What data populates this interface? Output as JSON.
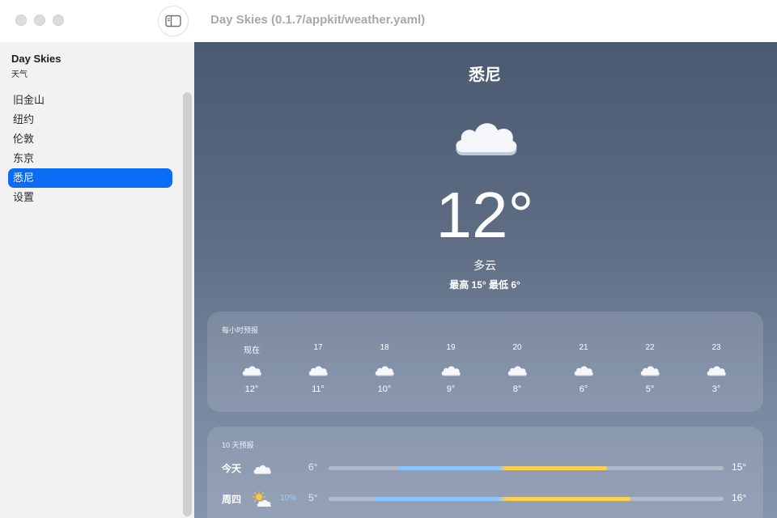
{
  "window": {
    "title": "Day Skies (0.1.7/appkit/weather.yaml)"
  },
  "sidebar": {
    "app_name": "Day Skies",
    "app_subtitle": "天气",
    "items": [
      {
        "label": "旧金山",
        "selected": false
      },
      {
        "label": "纽约",
        "selected": false
      },
      {
        "label": "伦敦",
        "selected": false
      },
      {
        "label": "东京",
        "selected": false
      },
      {
        "label": "悉尼",
        "selected": true
      },
      {
        "label": "设置",
        "selected": false
      }
    ]
  },
  "current": {
    "city": "悉尼",
    "icon": "cloud-icon",
    "temperature": "12°",
    "condition": "多云",
    "high_low": "最高 15° 最低 6°"
  },
  "hourly": {
    "title": "每小时预报",
    "hours": [
      {
        "time": "现在",
        "icon": "cloud-icon",
        "temp": "12°"
      },
      {
        "time": "17",
        "icon": "cloud-icon",
        "temp": "11°"
      },
      {
        "time": "18",
        "icon": "cloud-icon",
        "temp": "10°"
      },
      {
        "time": "19",
        "icon": "cloud-icon",
        "temp": "9°"
      },
      {
        "time": "20",
        "icon": "cloud-icon",
        "temp": "8°"
      },
      {
        "time": "21",
        "icon": "cloud-icon",
        "temp": "6°"
      },
      {
        "time": "22",
        "icon": "cloud-icon",
        "temp": "5°"
      },
      {
        "time": "23",
        "icon": "cloud-icon",
        "temp": "3°"
      }
    ]
  },
  "daily": {
    "title": "10 天预报",
    "range_min": 3,
    "range_max": 20,
    "days": [
      {
        "day": "今天",
        "icon": "cloud-icon",
        "precip": "",
        "low": "6°",
        "high": "15°",
        "low_value": 6,
        "high_value": 15
      },
      {
        "day": "周四",
        "icon": "partly-sunny-icon",
        "precip": "10%",
        "low": "5°",
        "high": "16°",
        "low_value": 5,
        "high_value": 16
      }
    ]
  },
  "colors": {
    "selection": "#0a6cf5",
    "bar_cool": "#8cc4ff",
    "bar_warm": "#ffd14a",
    "precip": "#9cd1ff"
  }
}
